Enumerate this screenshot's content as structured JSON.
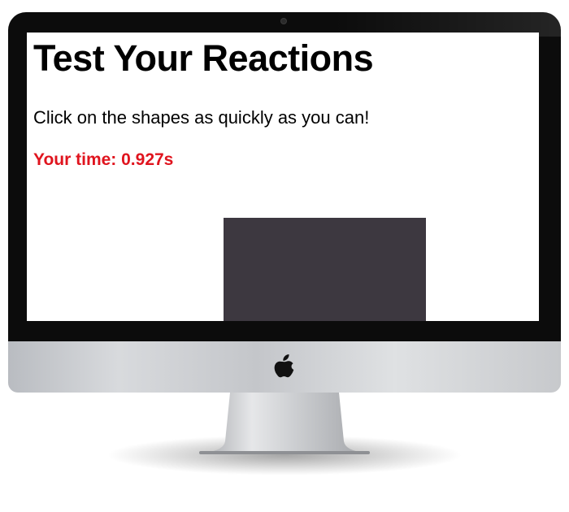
{
  "page": {
    "title": "Test Your Reactions",
    "instructions": "Click on the shapes as quickly as you can!",
    "time_label": "Your time: ",
    "time_value": "0.927s"
  },
  "colors": {
    "time_text": "#e0141e",
    "shape_fill": "#3d3840",
    "bezel": "#0c0c0c"
  },
  "icons": {
    "monitor": "apple-logo-icon"
  }
}
